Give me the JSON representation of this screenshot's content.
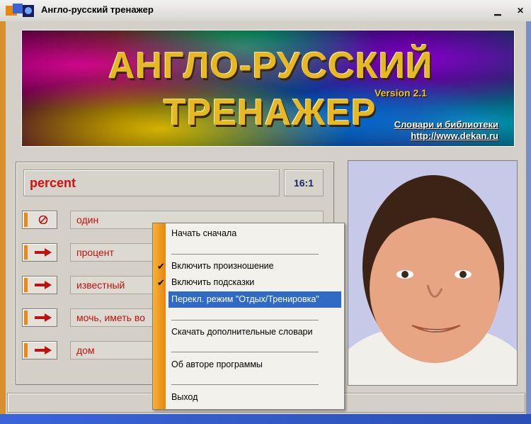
{
  "window": {
    "title": "Англо-русский тренажер",
    "min_label": "▁",
    "close_label": "✕"
  },
  "banner": {
    "line1": "АНГЛО-РУССКИЙ",
    "line2": "ТРЕНАЖЕР",
    "version": "Version 2.1",
    "link1": "Словари и библиотеки",
    "link2": "http://www.dekan.ru"
  },
  "quiz": {
    "word": "percent",
    "score": "16:1",
    "answers": [
      {
        "text": "один",
        "icon": "no-entry-icon"
      },
      {
        "text": "процент",
        "icon": "arrow-right-icon"
      },
      {
        "text": "известный",
        "icon": "arrow-right-icon"
      },
      {
        "text": "мочь, иметь во",
        "icon": "arrow-right-icon"
      },
      {
        "text": "дом",
        "icon": "arrow-right-icon"
      }
    ]
  },
  "context_menu": {
    "items": [
      {
        "label": "Начать сначала",
        "checked": false
      },
      {
        "label": "Включить произношение",
        "checked": true
      },
      {
        "label": "Включить подсказки",
        "checked": true
      },
      {
        "label": "Перекл. режим \"Отдых/Тренировка\"",
        "checked": false,
        "highlighted": true
      },
      {
        "label": "Скачать дополнительные словари",
        "checked": false
      },
      {
        "label": "Об авторе программы",
        "checked": false
      },
      {
        "label": "Выход",
        "checked": false
      }
    ],
    "check_mark": "✔"
  },
  "colors": {
    "accent_orange": "#e8860d",
    "highlight_blue": "#316ac5",
    "word_red": "#d01010"
  }
}
